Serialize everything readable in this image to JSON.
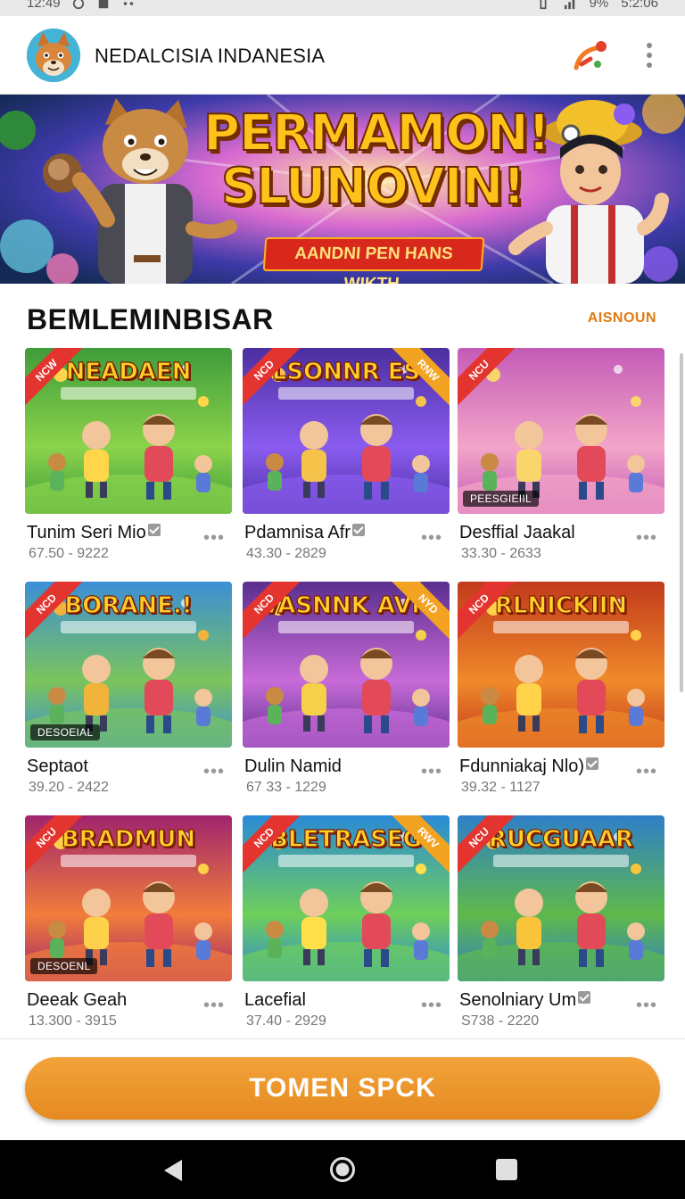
{
  "status_bar": {
    "time": "12:49",
    "battery": "9%",
    "clock_right": "5:2:06"
  },
  "app_bar": {
    "title": "NEDALCISIA INDANESIA",
    "share_icon": "share-icon",
    "more_icon": "more-vertical-icon"
  },
  "banner": {
    "title_line1": "PERMAMON!",
    "title_line2": "SLUNOVIN!",
    "ribbon": "AANDNI PEN HANS WIKTH"
  },
  "section": {
    "title": "BEMLEMINBISAR",
    "link": "AISNOUN"
  },
  "games": [
    {
      "thumb_title": "NEADAEN",
      "name": "Tunim Seri Mio",
      "meta": "67.50 - 9222",
      "verified": true,
      "tag": "",
      "ribbon_left": "NCW",
      "ribbon_right": "",
      "palette": [
        "#3f9c3a",
        "#8bd34b",
        "#ffd54a"
      ]
    },
    {
      "thumb_title": "LSONNR ES",
      "name": "Pdamnisa Afr",
      "meta": "43.30 - 2829",
      "verified": true,
      "tag": "",
      "ribbon_left": "NCD",
      "ribbon_right": "RNW",
      "palette": [
        "#4b2fa0",
        "#8a5cf0",
        "#f5c34a"
      ]
    },
    {
      "thumb_title": "",
      "name": "Desffial Jaakal",
      "meta": "33.30 - 2633",
      "verified": false,
      "tag": "PEESGIEIIL",
      "ribbon_left": "NCU",
      "ribbon_right": "",
      "palette": [
        "#c45bb8",
        "#f3a5c8",
        "#f9d66b"
      ]
    },
    {
      "thumb_title": "BORANE.!",
      "name": "Septaot",
      "meta": "39.20 - 2422",
      "verified": false,
      "tag": "DESOEIAL",
      "ribbon_left": "NCD",
      "ribbon_right": "",
      "palette": [
        "#3c8fd6",
        "#7bc45c",
        "#f0b43a"
      ]
    },
    {
      "thumb_title": "VASNNK AVN",
      "name": "Dulin Namid",
      "meta": "67 33 - 1229",
      "verified": false,
      "tag": "",
      "ribbon_left": "NCD",
      "ribbon_right": "NYD",
      "palette": [
        "#5b2e8f",
        "#c86bd8",
        "#f7d04a"
      ]
    },
    {
      "thumb_title": "RLNICKIIN",
      "name": "Fdunniakaj Nlo)",
      "meta": "39.32 - 1127",
      "verified": true,
      "tag": "",
      "ribbon_left": "NCD",
      "ribbon_right": "",
      "palette": [
        "#c23a1c",
        "#f08a2a",
        "#ffd24a"
      ]
    },
    {
      "thumb_title": "BRADMUN",
      "name": "Deeak Geah",
      "meta": "13.300 - 3915",
      "verified": false,
      "tag": "DESOENL",
      "ribbon_left": "NCU",
      "ribbon_right": "",
      "palette": [
        "#a0246e",
        "#f27d3a",
        "#ffd04a"
      ]
    },
    {
      "thumb_title": "BLETRASEG",
      "name": "Lacefial",
      "meta": "37.40 - 2929",
      "verified": false,
      "tag": "",
      "ribbon_left": "NCD",
      "ribbon_right": "RWV",
      "palette": [
        "#2a8ad6",
        "#6fcf5a",
        "#ffe04a"
      ]
    },
    {
      "thumb_title": "RUCGUAAR",
      "name": "Senolniary Um",
      "meta": "S738 - 2220",
      "verified": true,
      "tag": "",
      "ribbon_left": "NCU",
      "ribbon_right": "",
      "palette": [
        "#2f7fc8",
        "#5fb94a",
        "#f9c43a"
      ]
    }
  ],
  "cta": {
    "label": "TOMEN SPCK"
  }
}
